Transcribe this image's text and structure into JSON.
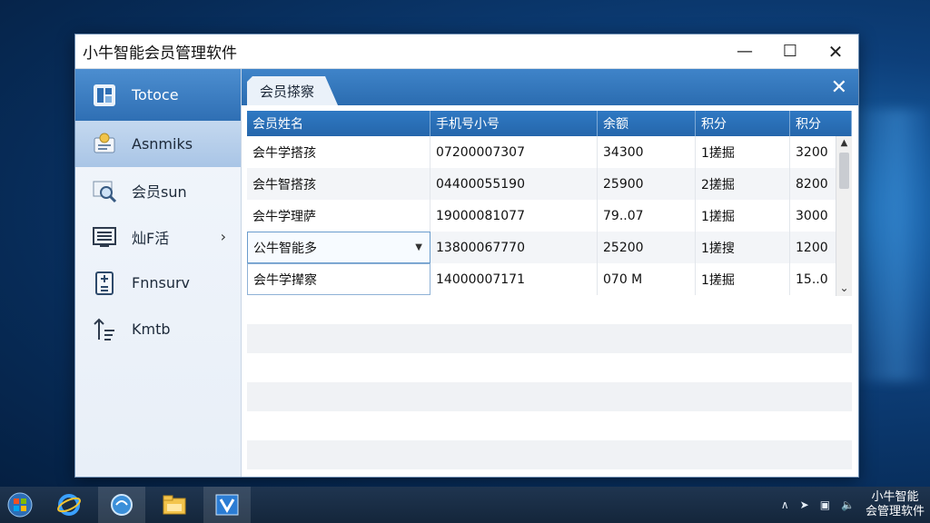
{
  "window": {
    "title": "小牛智能会员管理软件",
    "controls": {
      "minimize": "—",
      "maximize": "☐",
      "close": "✕"
    }
  },
  "sidebar": {
    "items": [
      {
        "label": "Totoce",
        "icon": "app-logo-icon"
      },
      {
        "label": "Asnmiks",
        "icon": "member-card-icon"
      },
      {
        "label": "会员sun",
        "icon": "search-icon"
      },
      {
        "label": "灿F活",
        "icon": "list-icon",
        "has_arrow": true
      },
      {
        "label": "Fnnsurv",
        "icon": "calculator-icon"
      },
      {
        "label": "Kmtb",
        "icon": "sort-icon"
      }
    ]
  },
  "tab": {
    "label": "会员搽察",
    "close": "✕"
  },
  "table": {
    "columns": [
      "会员姓名",
      "手机号小号",
      "余额",
      "积分",
      "积分"
    ],
    "rows": [
      [
        "会牛学搭孩",
        "07200007307",
        "34300",
        "1搓掘",
        "3200"
      ],
      [
        "会牛智搭孩",
        "04400055190",
        "25900",
        "2搓掘",
        "8200"
      ],
      [
        "会牛学理萨",
        "19000081077",
        "79..07",
        "1搓掘",
        "3000"
      ],
      [
        "公牛智能多",
        "13800067770",
        "25200",
        "1搓搜",
        "1200"
      ],
      [
        "会牛学撵察",
        "14000007171",
        "070 M",
        "1搓掘",
        "15..0"
      ]
    ],
    "editing_row_index": 3
  },
  "taskbar": {
    "apps": [
      "start-orb-icon",
      "ie-icon",
      "browser-icon",
      "folder-icon",
      "app-icon"
    ],
    "tray": {
      "clock_line1": "小牛智能",
      "clock_line2": "会管理软件"
    }
  },
  "colors": {
    "accent": "#2b6cb0",
    "header": "#2566ab",
    "selected": "#a9c5e6"
  }
}
